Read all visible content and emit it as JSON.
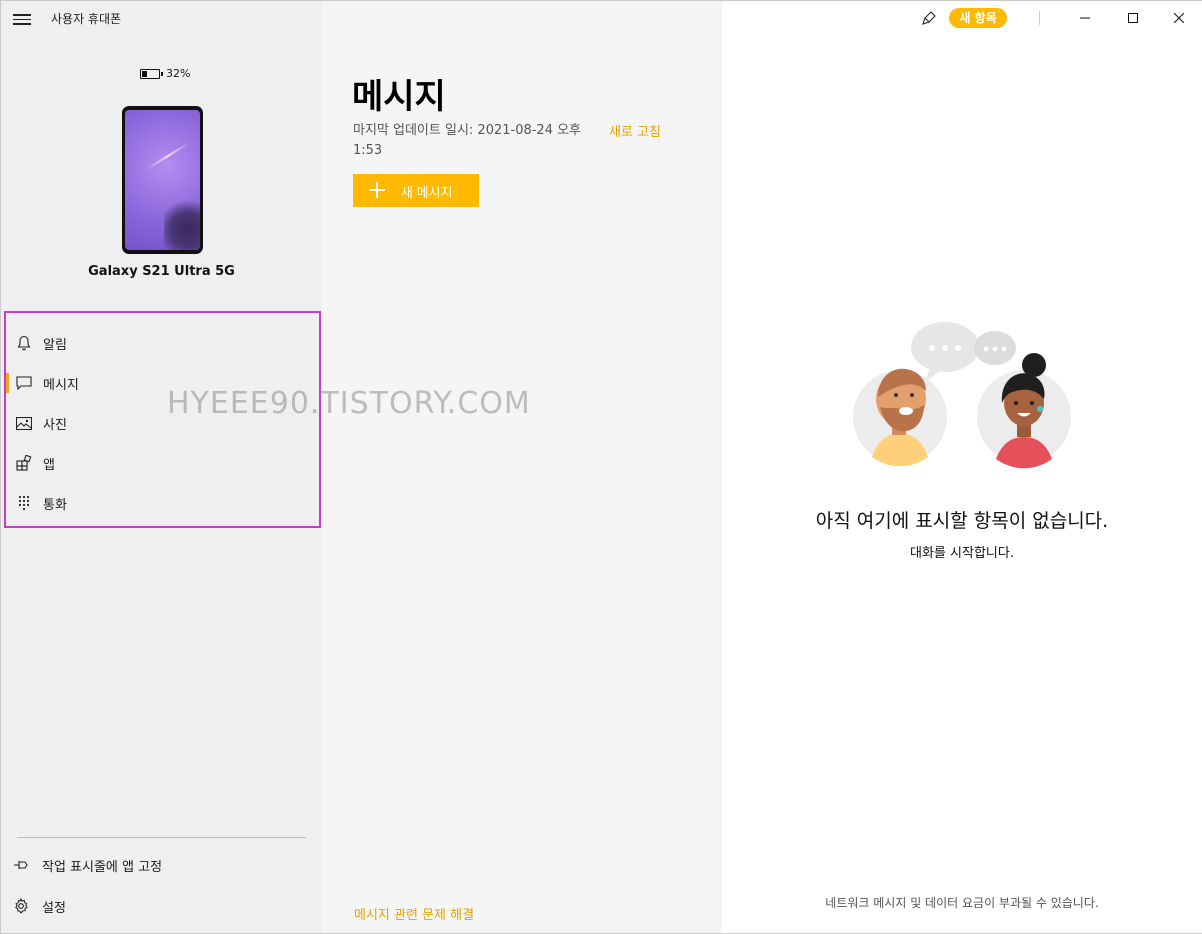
{
  "app": {
    "title": "사용자 휴대폰"
  },
  "device": {
    "battery": "32%",
    "battery_level": 0.32,
    "name": "Galaxy S21 Ultra 5G"
  },
  "nav": {
    "items": [
      {
        "label": "알림",
        "icon": "bell-icon"
      },
      {
        "label": "메시지",
        "icon": "chat-icon",
        "active": true
      },
      {
        "label": "사진",
        "icon": "photo-icon"
      },
      {
        "label": "앱",
        "icon": "apps-icon"
      },
      {
        "label": "통화",
        "icon": "dialpad-icon"
      }
    ]
  },
  "bottom": {
    "pin_label": "작업 표시줄에 앱 고정",
    "settings_label": "설정"
  },
  "messages": {
    "title": "메시지",
    "last_update": "마지막 업데이트 일시: 2021-08-24 오후 1:53",
    "refresh": "새로 고침",
    "new_message": "새 메시지",
    "troubleshoot": "메시지 관련 문제 해결"
  },
  "titlebar": {
    "new_items": "새 항목"
  },
  "empty": {
    "title": "아직 여기에 표시할 항목이 없습니다.",
    "subtitle": "대화를 시작합니다.",
    "footer": "네트워크 메시지 및 데이터 요금이 부과될 수 있습니다."
  },
  "watermark": "HYEEE90.TISTORY.COM",
  "colors": {
    "accent": "#ffb900",
    "link": "#e3a300",
    "nav_highlight": "#c23fc9",
    "active_marker": "#f7a21b"
  }
}
